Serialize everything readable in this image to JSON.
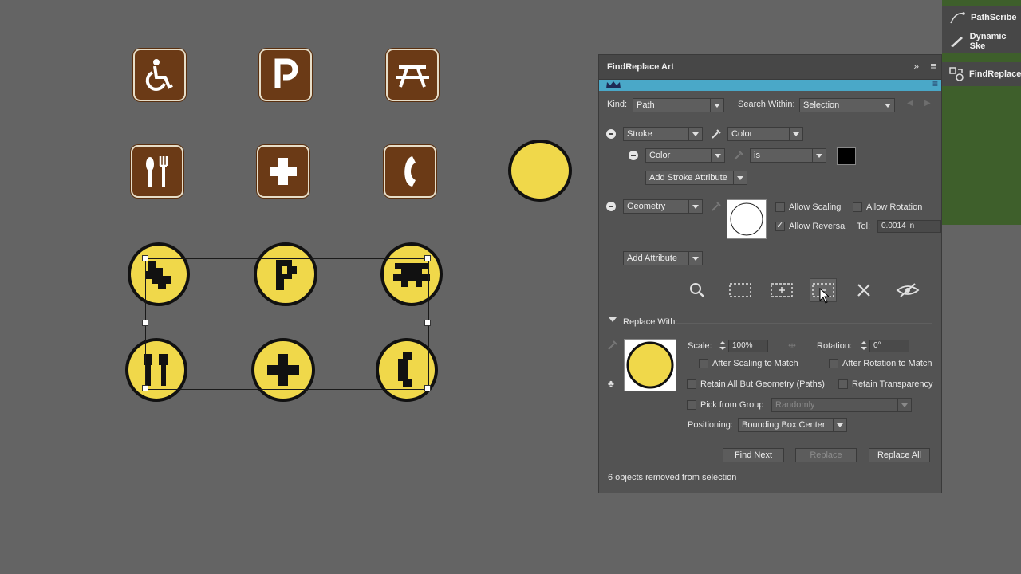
{
  "right_panel_tabs": [
    {
      "label": "PathScribe",
      "icon": "pathscribe-icon"
    },
    {
      "label": "Dynamic Ske",
      "icon": "dynamic-sketch-icon"
    },
    {
      "label": "FindReplace",
      "icon": "findreplace-icon"
    }
  ],
  "panel": {
    "title": "FindReplace Art",
    "kind_label": "Kind:",
    "kind_value": "Path",
    "search_within_label": "Search Within:",
    "search_within_value": "Selection",
    "stroke_attr": "Stroke",
    "stroke_prop": "Color",
    "color_attr": "Color",
    "color_op": "is",
    "color_swatch": "#000000",
    "add_stroke_attribute": "Add Stroke Attribute",
    "geometry_attr": "Geometry",
    "allow_scaling": "Allow Scaling",
    "allow_rotation": "Allow Rotation",
    "allow_reversal": "Allow Reversal",
    "tol_label": "Tol:",
    "tol_value": "0.0014 in",
    "add_attribute": "Add Attribute",
    "replace_with": "Replace With:",
    "scale_label": "Scale:",
    "scale_value": "100%",
    "rotation_label": "Rotation:",
    "rotation_value": "0°",
    "after_scaling": "After Scaling to Match",
    "after_rotation": "After Rotation to Match",
    "retain_all_but_geometry": "Retain All But Geometry (Paths)",
    "retain_transparency": "Retain Transparency",
    "pick_from_group": "Pick from Group",
    "pick_mode": "Randomly",
    "positioning_label": "Positioning:",
    "positioning_value": "Bounding Box Center",
    "find_next": "Find Next",
    "replace": "Replace",
    "replace_all": "Replace All",
    "status": "6 objects removed from selection"
  },
  "colors": {
    "sign_brown": "#6b3a16",
    "symbol_yellow": "#f0d84a",
    "panel_bg": "#535353",
    "canvas_bg": "#646464",
    "accent_blue": "#4aa8c8"
  },
  "canvas_signs": [
    "wheelchair-icon",
    "parking-icon",
    "picnic-table-icon",
    "utensils-icon",
    "first-aid-icon",
    "telephone-icon"
  ]
}
